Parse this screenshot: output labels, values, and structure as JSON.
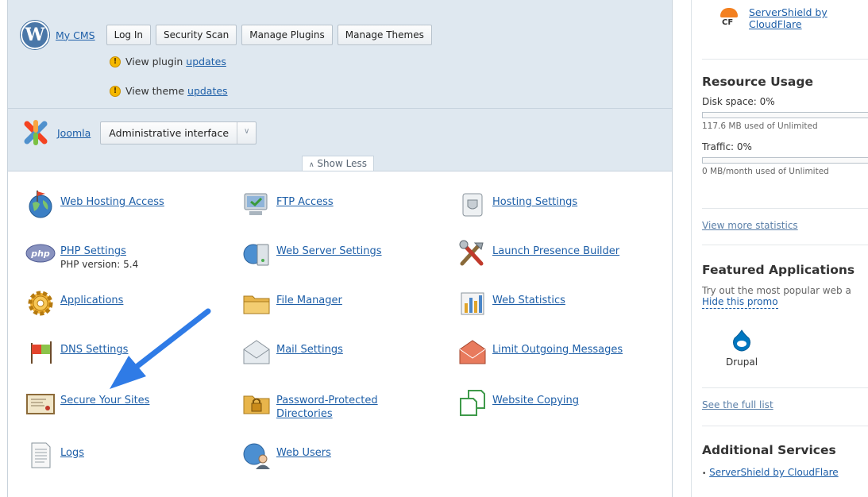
{
  "top": {
    "cms_link": "My CMS",
    "buttons": [
      "Log In",
      "Security Scan",
      "Manage Plugins",
      "Manage Themes"
    ],
    "notice_plugin_text": "View plugin",
    "notice_plugin_link": "updates",
    "notice_theme_text": "View theme",
    "notice_theme_link": "updates",
    "joomla_link": "Joomla",
    "joomla_select": "Administrative interface",
    "show_less": "Show Less"
  },
  "tiles": {
    "web_hosting_access": "Web Hosting Access",
    "ftp_access": "FTP Access",
    "hosting_settings": "Hosting Settings",
    "php_settings": "PHP Settings",
    "php_version": "PHP version: 5.4",
    "web_server_settings": "Web Server Settings",
    "launch_presence_builder": "Launch Presence Builder",
    "applications": "Applications",
    "file_manager": "File Manager",
    "web_statistics": "Web Statistics",
    "dns_settings": "DNS Settings",
    "mail_settings": "Mail Settings",
    "limit_outgoing_messages": "Limit Outgoing Messages",
    "secure_your_sites": "Secure Your Sites",
    "password_protected_1": "Password-Protected",
    "password_protected_2": "Directories",
    "website_copying": "Website Copying",
    "logs": "Logs",
    "web_users": "Web Users"
  },
  "sidebar": {
    "servershield_1": "ServerShield by",
    "servershield_2": "CloudFlare",
    "cf_badge": "CF",
    "resource_title": "Resource Usage",
    "disk_label": "Disk space: 0%",
    "disk_percent": 0,
    "disk_detail": "117.6 MB used of Unlimited",
    "traffic_label": "Traffic: 0%",
    "traffic_percent": 0,
    "traffic_detail": "0 MB/month used of Unlimited",
    "view_stats": "View more statistics",
    "featured_title": "Featured Applications",
    "featured_text": "Try out the most popular web a",
    "hide_promo": "Hide this promo",
    "drupal": "Drupal",
    "see_full_list": "See the full list",
    "additional_title": "Additional Services",
    "additional_item": "ServerShield by CloudFlare"
  },
  "colors": {
    "link": "#1e5fa8",
    "arrow": "#2f7be6",
    "top_bg": "#dfe8f0"
  }
}
